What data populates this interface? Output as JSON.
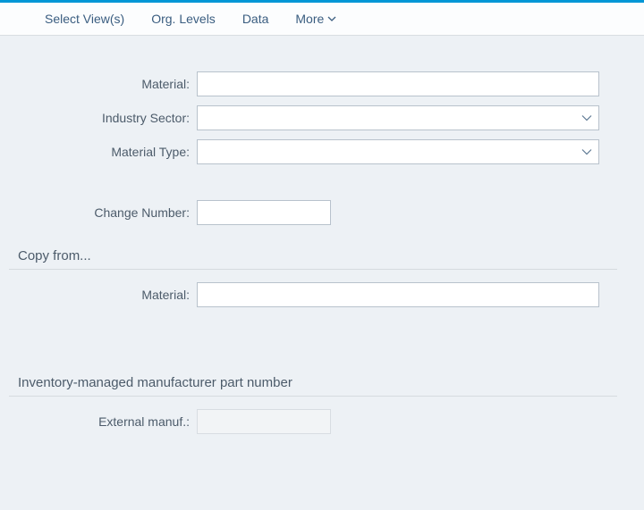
{
  "toolbar": {
    "select_views": "Select View(s)",
    "org_levels": "Org. Levels",
    "data": "Data",
    "more": "More"
  },
  "form": {
    "material_label": "Material:",
    "material_value": "",
    "industry_sector_label": "Industry Sector:",
    "industry_sector_value": "",
    "material_type_label": "Material Type:",
    "material_type_value": "",
    "change_number_label": "Change Number:",
    "change_number_value": ""
  },
  "copy_from": {
    "title": "Copy from...",
    "material_label": "Material:",
    "material_value": ""
  },
  "inventory": {
    "title": "Inventory-managed manufacturer part number",
    "external_manuf_label": "External manuf.:",
    "external_manuf_value": ""
  }
}
